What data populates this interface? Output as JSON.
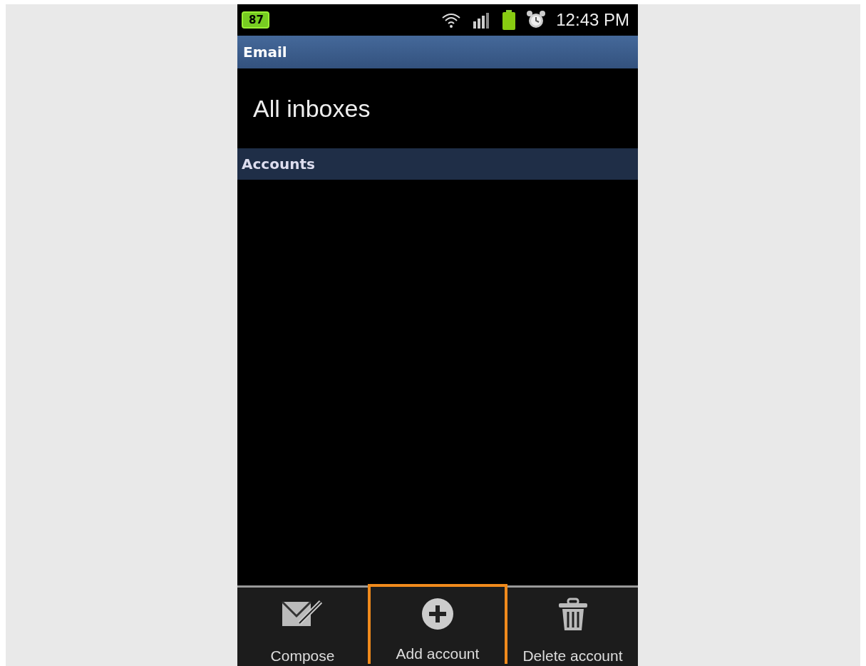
{
  "status_bar": {
    "notification_badge": "87",
    "time": "12:43 PM"
  },
  "header": {
    "title": "Email"
  },
  "inbox": {
    "label": "All inboxes"
  },
  "section": {
    "title": "Accounts"
  },
  "bottom_actions": [
    {
      "kind": "compose",
      "label": "Compose",
      "selected": false
    },
    {
      "kind": "add",
      "label": "Add account",
      "selected": true
    },
    {
      "kind": "delete",
      "label": "Delete account",
      "selected": false
    }
  ]
}
